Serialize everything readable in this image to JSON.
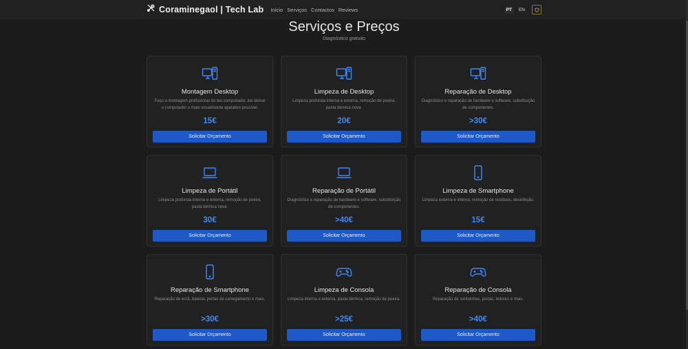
{
  "nav": {
    "brand": "Coraminegaol | Tech Lab",
    "links": [
      "Início",
      "Serviços",
      "Contactos",
      "Reviews"
    ],
    "languages": [
      "PT",
      "EN"
    ]
  },
  "hero": {
    "title": "Serviços e Preços",
    "subtitle": "Diagnóstico gratuito"
  },
  "cards": [
    {
      "icon": "desktop-icon",
      "title": "Montagem Desktop",
      "desc": "Faço a montagem profissional do teu computador, irei deixar o computador o mais visualmente apelativo possível.",
      "price": "15€",
      "button": "Solicitar Orçamento"
    },
    {
      "icon": "desktop-icon",
      "title": "Limpeza de Desktop",
      "desc": "Limpeza profunda interna e externa, remoção de poeira, pasta térmica nova.",
      "price": "20€",
      "button": "Solicitar Orçamento"
    },
    {
      "icon": "desktop-icon",
      "title": "Reparação de Desktop",
      "desc": "Diagnóstico e reparação de hardware e software, substituição de componentes.",
      "price": ">30€",
      "button": "Solicitar Orçamento"
    },
    {
      "icon": "laptop-icon",
      "title": "Limpeza de Portátil",
      "desc": "Limpeza profunda interna e externa, remoção de poeira, pasta térmica nova.",
      "price": "30€",
      "button": "Solicitar Orçamento"
    },
    {
      "icon": "laptop-icon",
      "title": "Reparação de Portátil",
      "desc": "Diagnóstico e reparação de hardware e software, substituição de componentes.",
      "price": ">40€",
      "button": "Solicitar Orçamento"
    },
    {
      "icon": "phone-icon",
      "title": "Limpeza de Smartphone",
      "desc": "Limpeza externa e interna, remoção de resíduos, desinfeção.",
      "price": "15€",
      "button": "Solicitar Orçamento"
    },
    {
      "icon": "phone-icon",
      "title": "Reparação de Smartphone",
      "desc": "Reparação de ecrã, bateria, portas de carregamento e mais.",
      "price": ">30€",
      "button": "Solicitar Orçamento"
    },
    {
      "icon": "gamepad-icon",
      "title": "Limpeza de Consola",
      "desc": "Limpeza interna e externa, pasta térmica, remoção de poeira.",
      "price": ">25€",
      "button": "Solicitar Orçamento"
    },
    {
      "icon": "gamepad-icon",
      "title": "Reparação de Consola",
      "desc": "Reparação de ventoinhas, portas, leitores e mais.",
      "price": ">40€",
      "button": "Solicitar Orçamento"
    }
  ],
  "colors": {
    "accent": "#3d8bfd",
    "button": "#1d59c7",
    "background": "#1c1c1c",
    "card": "#212121"
  }
}
